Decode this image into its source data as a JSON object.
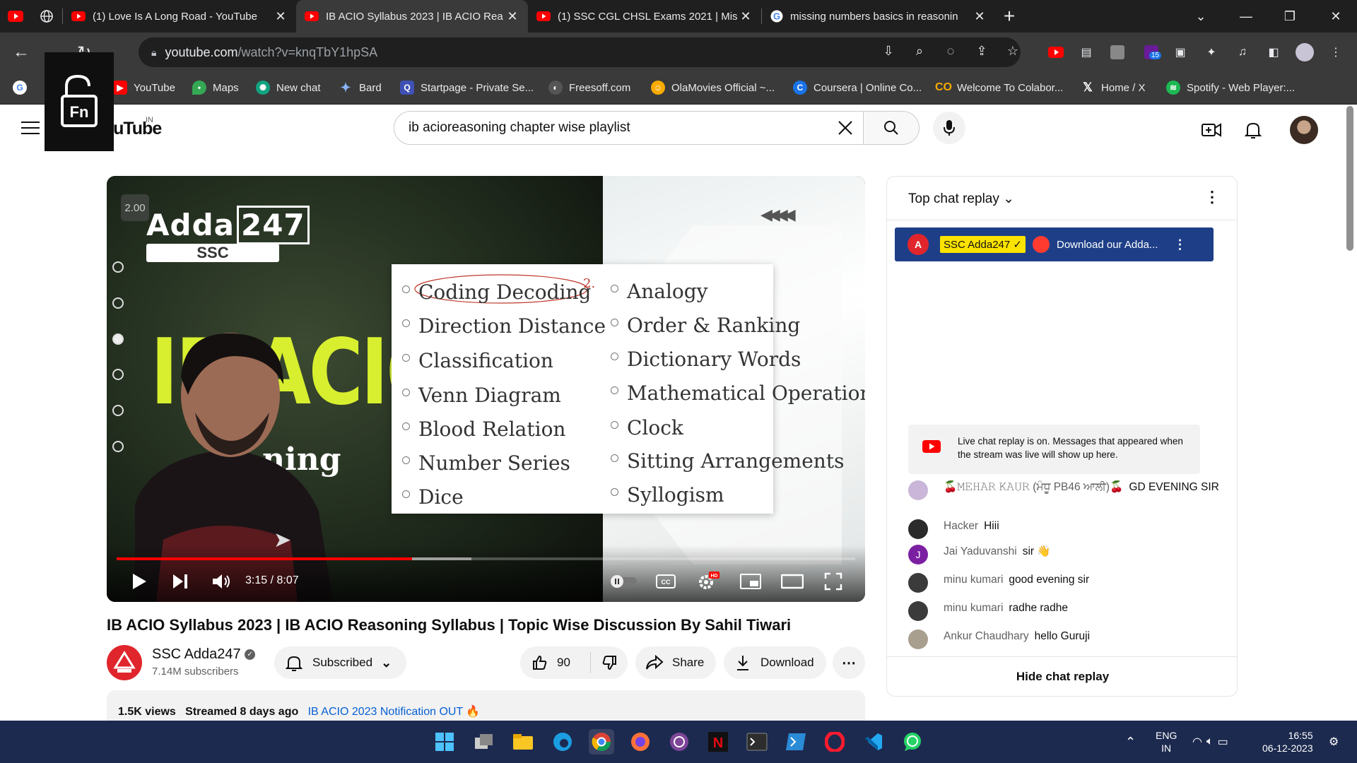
{
  "browser": {
    "tabs": [
      {
        "title": "(1) Love Is A Long Road - YouTube",
        "icon": "youtube-icon"
      },
      {
        "title": "IB ACIO Syllabus 2023 | IB ACIO Rea",
        "icon": "youtube-icon",
        "active": true
      },
      {
        "title": "(1) SSC CGL CHSL Exams 2021 | Mis",
        "icon": "youtube-icon"
      },
      {
        "title": "missing numbers basics in reasonin",
        "icon": "google-icon"
      }
    ],
    "url_host": "youtube.com",
    "url_path": "/watch?v=knqTbY1hpSA",
    "extension_badge": "15",
    "bookmarks": [
      "YouTube",
      "Maps",
      "New chat",
      "Bard",
      "Startpage - Private Se...",
      "Freesoff.com",
      "OlaMovies Official ~...",
      "Coursera | Online Co...",
      "Welcome To Colabor...",
      "Home / X",
      "Spotify - Web Player:..."
    ]
  },
  "youtube": {
    "logo_text": "YouTube",
    "country": "IN",
    "search_value": "ib acioreasoning chapter wise playlist",
    "player": {
      "speed": "2.00",
      "brand_name": "Adda",
      "brand_number": "247",
      "brand_tag": "SSC",
      "big_text": "IB ACIO",
      "sub_text": "ning",
      "topics_left": [
        "Coding Decoding",
        "Direction Distance",
        "Classification",
        "Venn Diagram",
        "Blood Relation",
        "Number Series",
        "Dice"
      ],
      "topics_right": [
        "Analogy",
        "Order & Ranking",
        "Dictionary Words",
        "Mathematical Operation",
        "Clock",
        "Sitting Arrangements",
        "Syllogism"
      ],
      "annotation": "2.",
      "time": "3:15 / 8:07",
      "progress_fraction": 0.4,
      "buffered_fraction": 0.48
    },
    "video": {
      "title": "IB ACIO Syllabus 2023 | IB ACIO Reasoning Syllabus | Topic Wise Discussion By Sahil Tiwari",
      "channel": "SSC Adda247",
      "subscribers": "7.14M subscribers",
      "subscribe_label": "Subscribed",
      "likes": "90",
      "share_label": "Share",
      "download_label": "Download",
      "views": "1.5K views",
      "streamed": "Streamed 8 days ago",
      "desc_snippet": "IB ACIO 2023 Notification OUT"
    },
    "chat": {
      "header": "Top chat replay",
      "pinned_author": "SSC Adda247",
      "pinned_text": "Download our Adda...",
      "notice": "Live chat replay is on. Messages that appeared when the stream was live will show up here.",
      "messages": [
        {
          "author": "🍒𝙼𝙴𝙷𝙰𝚁 𝙺𝙰𝚄𝚁 (ਮੰਧੂ PB46 ਆਲੀ)🍒",
          "text": "GD EVENING SIR",
          "color": "#c9b6d8",
          "initial": ""
        },
        {
          "author": "Hacker",
          "text": "Hiii",
          "color": "#2b2b2b",
          "initial": ""
        },
        {
          "author": "Jai Yaduvanshi",
          "text": "sir 👋",
          "color": "#7b1fa2",
          "initial": "J"
        },
        {
          "author": "minu kumari",
          "text": "good evening sir",
          "color": "#3b3b3b",
          "initial": ""
        },
        {
          "author": "minu kumari",
          "text": "radhe radhe",
          "color": "#3b3b3b",
          "initial": ""
        },
        {
          "author": "Ankur Chaudhary",
          "text": "hello Guruji",
          "color": "#a89f8f",
          "initial": ""
        }
      ],
      "footer": "Hide chat replay"
    }
  },
  "taskbar": {
    "lang": "ENG",
    "region": "IN",
    "time": "16:55",
    "date": "06-12-2023"
  },
  "colors": {
    "accent_red": "#ff0000",
    "chat_pinned_bg": "#1e3f88",
    "taskbar_bg": "#1d2a4f"
  }
}
